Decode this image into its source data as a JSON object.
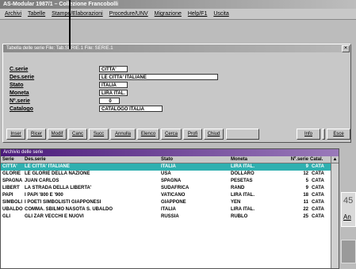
{
  "app": {
    "title": "AS-Modular 1987/1 – Collezione Francobolli",
    "menu": [
      "Archivi",
      "Tabelle",
      "Stampe/Elaborazioni",
      "Procedure/UNV",
      "Migrazione",
      "Help/F1",
      "Uscita"
    ]
  },
  "form": {
    "title": "Tabella delle serie  File: Tab.SERIE.1        File: SERIE.1",
    "fields": [
      {
        "label": "C.serie",
        "value": "CITTA'"
      },
      {
        "label": "Des.serie",
        "value": "LE CITTA' ITALIANE"
      },
      {
        "label": "Stato",
        "value": "ITALIA"
      },
      {
        "label": "Moneta",
        "value": "LIRA ITAL."
      },
      {
        "label": "Nº.serie",
        "value": "0"
      },
      {
        "label": "Catalogo",
        "value": "CATALOGO ITALIA"
      }
    ],
    "buttons": [
      "Inser",
      "Ricer",
      "Modif",
      "Canc",
      "Succ",
      "Annulla",
      "Elenco",
      "Cerca",
      "Profi",
      "Chiud",
      "",
      "Info",
      "",
      "Esce"
    ]
  },
  "list": {
    "title": "Archivio delle serie",
    "columns": [
      "Serie",
      "Des.serie",
      "Stato",
      "Moneta",
      "Nº.serie",
      "Catal."
    ],
    "rows": [
      {
        "code": "CITTA'",
        "desc": "LE CITTA' ITALIANE",
        "stato": "ITALIA",
        "moneta": "LIRA ITAL.",
        "nserie": "9",
        "cat": "CATA",
        "selected": true
      },
      {
        "code": "GLORIE",
        "desc": "LE GLORIE DELLA NAZIONE",
        "stato": "USA",
        "moneta": "DOLLARO",
        "nserie": "12",
        "cat": "CATA",
        "selected": false
      },
      {
        "code": "SPAGNA",
        "desc": "JUAN CARLOS",
        "stato": "SPAGNA",
        "moneta": "PESETAS",
        "nserie": "5",
        "cat": "CATA",
        "selected": false
      },
      {
        "code": "LIBERT",
        "desc": "LA STRADA DELLA LIBERTA'",
        "stato": "SUDAFRICA",
        "moneta": "RAND",
        "nserie": "9",
        "cat": "CATA",
        "selected": false
      },
      {
        "code": "PAPI",
        "desc": "I PAPI '800 E '900",
        "stato": "VATICANO",
        "moneta": "LIRA ITAL.",
        "nserie": "18",
        "cat": "CATA",
        "selected": false
      },
      {
        "code": "SIMBOLI",
        "desc": "I POETI SIMBOLISTI GIAPPONESI",
        "stato": "GIAPPONE",
        "moneta": "YEN",
        "nserie": "11",
        "cat": "CATA",
        "selected": false
      },
      {
        "code": "UBALDO",
        "desc": "COMMA. SBILMO NASOTA S. UBALDO",
        "stato": "ITALIA",
        "moneta": "LIRA ITAL.",
        "nserie": "22",
        "cat": "CATA",
        "selected": false
      },
      {
        "code": "GLI",
        "desc": "GLI ZAR VECCHI E NUOVI",
        "stato": "RUSSIA",
        "moneta": "RUBLO",
        "nserie": "25",
        "cat": "CATA",
        "selected": false
      }
    ]
  },
  "side": {
    "card_text": "45",
    "link_text": "An"
  },
  "colors": {
    "selected_row": "#2fb0b0",
    "list_title": "#4a1a7a"
  }
}
